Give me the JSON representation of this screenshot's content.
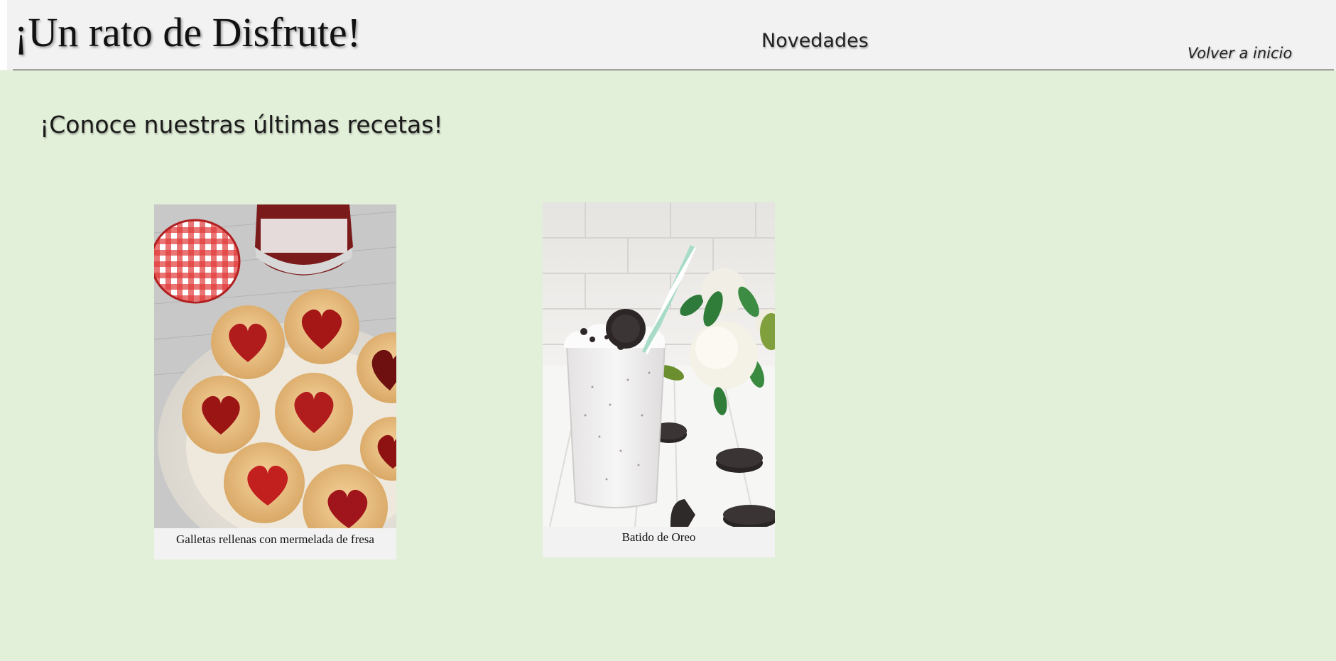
{
  "header": {
    "site_title": "¡Un rato de Disfrute!",
    "nav_current": "Novedades",
    "nav_home": "Volver a inicio"
  },
  "main": {
    "heading": "¡Conoce nuestras últimas recetas!",
    "recipes": [
      {
        "caption": "Galletas rellenas con mermelada de fresa",
        "image": "jam-heart-cookies-photo"
      },
      {
        "caption": "Batido de Oreo",
        "image": "oreo-milkshake-photo"
      }
    ]
  },
  "colors": {
    "page_background": "#e2efd9",
    "header_background": "#f2f2f2",
    "text": "#111111"
  }
}
